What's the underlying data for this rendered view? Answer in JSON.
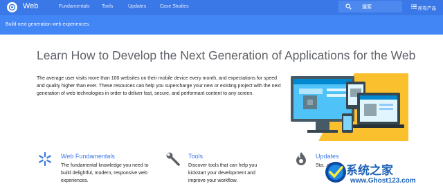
{
  "header": {
    "brand": "Web",
    "nav": [
      "Fundamentals",
      "Tools",
      "Updates",
      "Case Studies"
    ],
    "search_placeholder": "搜索",
    "language": "所有产品"
  },
  "banner": {
    "text": "Build next generation web experiences."
  },
  "main": {
    "headline": "Learn How to Develop the Next Generation of Applications for the Web",
    "intro": "The average user visits more than 100 websites on their mobile device every month, and expectations for speed and quality higher than ever. These resources can help you supercharge your new or existing project with the next generation of web technologies in order to deliver fast, secure, and performant content to any screen."
  },
  "features": [
    {
      "title": "Web Fundamentals",
      "desc": "The fundamental knowledge you need to build delightful, modern, responsive web experiences.",
      "icon": "snowflake-icon"
    },
    {
      "title": "Tools",
      "desc": "Discover tools that can help you kickstart your development and improve your workflow.",
      "icon": "wrench-icon"
    },
    {
      "title": "Updates",
      "desc": "Sta...date...",
      "icon": "flame-icon"
    }
  ],
  "watermark": {
    "title": "系统之家",
    "url": "www.Ghost123.com"
  },
  "colors": {
    "topbar": "#3b78e7",
    "banner": "#4285f4",
    "link": "#3b78e7",
    "hero_accent": "#fbc02d",
    "hero_dark": "#455a64"
  }
}
